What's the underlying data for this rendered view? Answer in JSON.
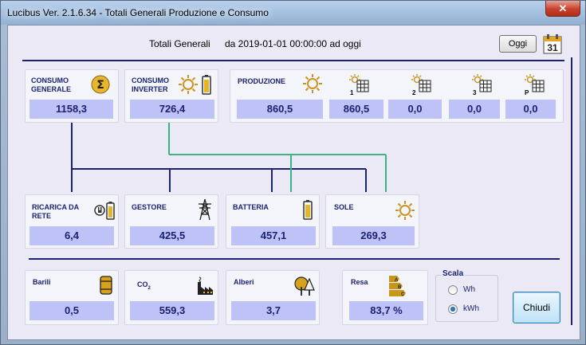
{
  "window": {
    "title": "Lucibus Ver. 2.1.6.34 -  Totali Generali Produzione e Consumo",
    "close_label": "✕"
  },
  "header": {
    "title": "Totali Generali",
    "range": "da 2019-01-01 00:00:00 ad oggi",
    "oggi_label": "Oggi",
    "calendar_day": "31"
  },
  "consumo_generale": {
    "label_1": "CONSUMO",
    "label_2": "GENERALE",
    "value": "1158,3",
    "icon": "sigma-icon"
  },
  "consumo_inverter": {
    "label_1": "CONSUMO",
    "label_2": "INVERTER",
    "value": "726,4",
    "icon": "sun-battery-icon"
  },
  "produzione": {
    "label": "PRODUZIONE",
    "total": "860,5",
    "inverters": [
      {
        "sub": "1",
        "value": "860,5"
      },
      {
        "sub": "2",
        "value": "0,0"
      },
      {
        "sub": "3",
        "value": "0,0"
      },
      {
        "sub": "P",
        "value": "0,0"
      }
    ]
  },
  "ricarica_da_rete": {
    "label_1": "RICARICA DA",
    "label_2": "RETE",
    "value": "6,4"
  },
  "gestore": {
    "label": "GESTORE",
    "value": "425,5"
  },
  "batteria": {
    "label": "BATTERIA",
    "value": "457,1"
  },
  "sole": {
    "label": "SOLE",
    "value": "269,3"
  },
  "barili": {
    "label": "Barili",
    "value": "0,5"
  },
  "co2": {
    "label": "CO",
    "sub": "2",
    "value": "559,3"
  },
  "alberi": {
    "label": "Alberi",
    "value": "3,7"
  },
  "resa": {
    "label": "Resa",
    "value": "83,7 %",
    "bar_letters": [
      "A",
      "B",
      "C"
    ]
  },
  "scala": {
    "title": "Scala",
    "options": [
      {
        "label": "Wh",
        "selected": false
      },
      {
        "label": "kWh",
        "selected": true
      }
    ]
  },
  "chiudi_label": "Chiudi",
  "colors": {
    "navy": "#1b2370",
    "green": "#3fb186",
    "value_bg": "#bfc2f7",
    "icon_gold": "#c8951e"
  }
}
